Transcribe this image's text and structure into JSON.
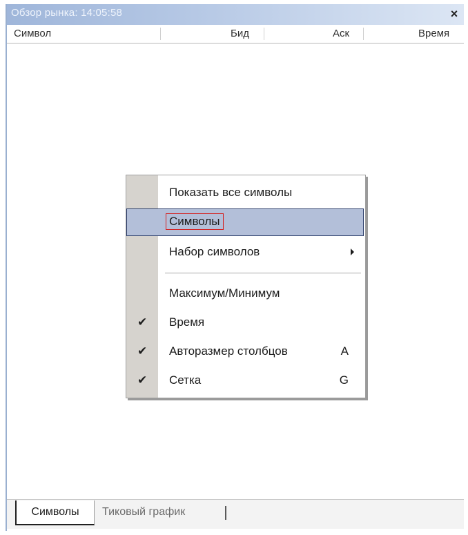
{
  "window": {
    "title": "Обзор рынка: 14:05:58",
    "close_label": "×"
  },
  "columns": [
    {
      "label": "Символ"
    },
    {
      "label": "Бид"
    },
    {
      "label": "Аск"
    },
    {
      "label": "Время"
    }
  ],
  "context_menu": {
    "items": [
      {
        "label": "Показать все символы",
        "checked": false,
        "shortcut": "",
        "submenu": false,
        "selected": false
      },
      {
        "label": "Символы",
        "checked": false,
        "shortcut": "",
        "submenu": false,
        "selected": true
      },
      {
        "label": "Набор символов",
        "checked": false,
        "shortcut": "",
        "submenu": true,
        "selected": false
      },
      {
        "label": "Максимум/Минимум",
        "checked": false,
        "shortcut": "",
        "submenu": false,
        "selected": false
      },
      {
        "label": "Время",
        "checked": true,
        "shortcut": "",
        "submenu": false,
        "selected": false
      },
      {
        "label": "Авторазмер столбцов",
        "checked": true,
        "shortcut": "A",
        "submenu": false,
        "selected": false
      },
      {
        "label": "Сетка",
        "checked": true,
        "shortcut": "G",
        "submenu": false,
        "selected": false
      }
    ],
    "check_glyph": "✔"
  },
  "tabs": [
    {
      "label": "Символы",
      "active": true
    },
    {
      "label": "Тиковый график",
      "active": false
    }
  ],
  "colors": {
    "selection": "#b3bfd9",
    "highlight_border": "#d42020",
    "title_gradient_start": "#9fb6da"
  }
}
